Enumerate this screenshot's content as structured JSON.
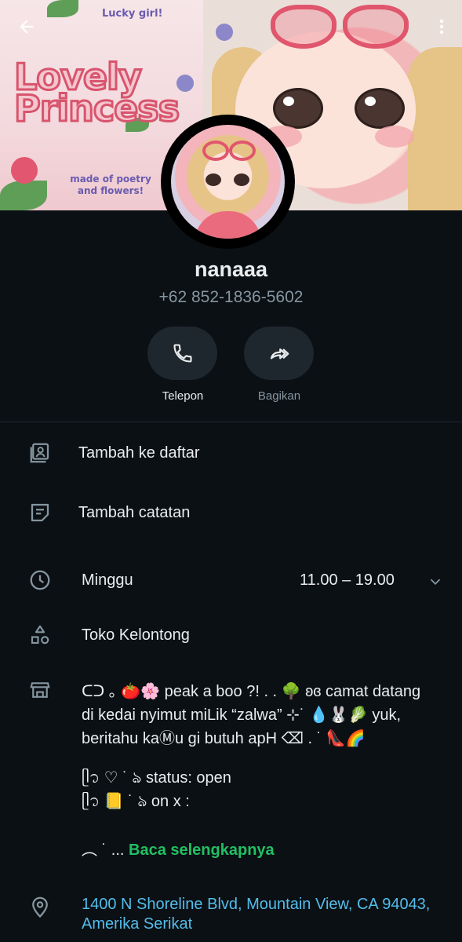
{
  "cover": {
    "lucky_text": "Lucky girl!",
    "title_text": "Lovely Princess",
    "subtitle_text": "made of poetry and flowers!"
  },
  "header": {
    "back_icon": "arrow-left-icon",
    "more_icon": "more-vertical-icon"
  },
  "profile": {
    "name": "nanaaa",
    "phone": "+62 852-1836-5602"
  },
  "actions": [
    {
      "label": "Telepon",
      "icon": "phone-icon"
    },
    {
      "label": "Bagikan",
      "icon": "share-forward-icon"
    }
  ],
  "menu": {
    "add_to_list": "Tambah ke daftar",
    "add_note": "Tambah catatan"
  },
  "business": {
    "day": "Minggu",
    "hours": "11.00 – 19.00",
    "category": "Toko Kelontong",
    "description_lines": [
      "ᑕᑐ ｡ 🍅🌸 peak a boo ?! . . 🌳 ʚɞ camat datang",
      "di kedai nyimut miLik “zalwa” ⊹˙ 💧🐰🥬 yuk,",
      "beritahu kaⓂu gi butuh apH ⌫ . ˙ 👠🌈"
    ],
    "status_lines": [
      "ᥫ᭡ ♡ ˙ ঌ status: open",
      "ᥫ᭡ 📒 ˙ ঌ on x :"
    ],
    "more_prefix": "︵ ˙ ... ",
    "read_more": "Baca selengkapnya",
    "address": "1400 N Shoreline Blvd, Mountain View, CA 94043, Amerika Serikat"
  },
  "colors": {
    "background": "#0b1014",
    "accent_green": "#21c063",
    "link_blue": "#53bdeb",
    "muted": "#8696a0"
  }
}
